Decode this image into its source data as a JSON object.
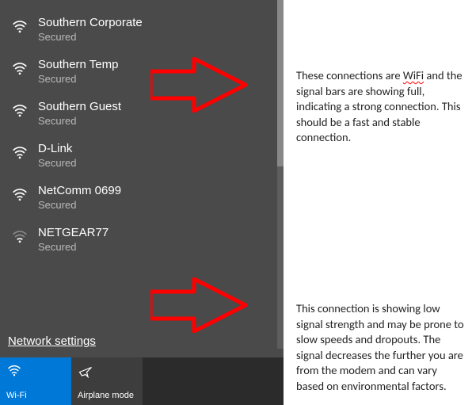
{
  "panel": {
    "networks": [
      {
        "name": "Southern Corporate",
        "status": "Secured",
        "signal": "full"
      },
      {
        "name": "Southern Temp",
        "status": "Secured",
        "signal": "full"
      },
      {
        "name": "Southern Guest",
        "status": "Secured",
        "signal": "full"
      },
      {
        "name": "D-Link",
        "status": "Secured",
        "signal": "full"
      },
      {
        "name": "NetComm 0699",
        "status": "Secured",
        "signal": "full"
      },
      {
        "name": "NETGEAR77",
        "status": "Secured",
        "signal": "low"
      }
    ],
    "settings_link": "Network settings",
    "toggles": {
      "wifi": {
        "label": "Wi-Fi",
        "active": true
      },
      "airplane": {
        "label": "Airplane mode",
        "active": false
      }
    }
  },
  "annotations": {
    "top": "These connections are WiFi and the signal bars are showing full, indicating a strong connection.  This should be a fast and stable connection.",
    "bottom": "This connection is showing low signal strength and may be prone to slow speeds and dropouts.  The signal decreases the further you are from the modem and can vary based on environmental factors.",
    "squiggle_word": "WiFi"
  }
}
